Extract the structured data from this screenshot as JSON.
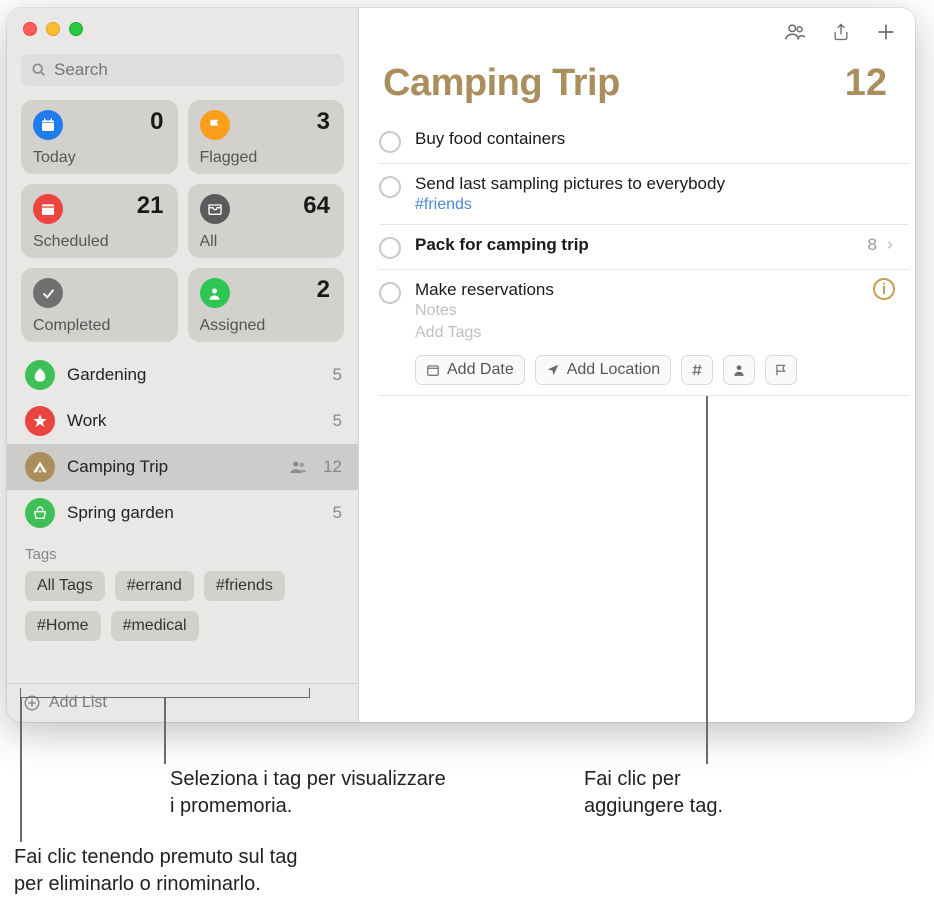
{
  "search": {
    "placeholder": "Search"
  },
  "smartLists": {
    "today": {
      "label": "Today",
      "count": "0",
      "color": "#227bea"
    },
    "flagged": {
      "label": "Flagged",
      "count": "3",
      "color": "#fa9e1b"
    },
    "scheduled": {
      "label": "Scheduled",
      "count": "21",
      "color": "#eb4542"
    },
    "all": {
      "label": "All",
      "count": "64",
      "color": "#5b5b5d"
    },
    "completed": {
      "label": "Completed",
      "count": "",
      "color": "#707072"
    },
    "assigned": {
      "label": "Assigned",
      "count": "2",
      "color": "#30c552"
    }
  },
  "lists": [
    {
      "name": "Gardening",
      "count": "5",
      "color": "#3fbf57",
      "selected": false,
      "shared": false,
      "icon": "leaf"
    },
    {
      "name": "Work",
      "count": "5",
      "color": "#eb4542",
      "selected": false,
      "shared": false,
      "icon": "star"
    },
    {
      "name": "Camping Trip",
      "count": "12",
      "color": "#ab8e5e",
      "selected": true,
      "shared": true,
      "icon": "tent"
    },
    {
      "name": "Spring garden",
      "count": "5",
      "color": "#3fbf57",
      "selected": false,
      "shared": false,
      "icon": "basket"
    }
  ],
  "tagsSection": {
    "title": "Tags",
    "items": [
      "All Tags",
      "#errand",
      "#friends",
      "#Home",
      "#medical"
    ]
  },
  "addList": "Add List",
  "main": {
    "title": "Camping Trip",
    "count": "12",
    "todos": [
      {
        "title": "Buy food containers"
      },
      {
        "title": "Send last sampling pictures to everybody",
        "tag": "#friends"
      },
      {
        "title": "Pack for camping trip",
        "bold": true,
        "subcount": "8"
      },
      {
        "title": "Make reservations",
        "editing": true,
        "notes": "Notes",
        "addTags": "Add Tags",
        "chips": {
          "date": "Add Date",
          "location": "Add Location"
        }
      }
    ]
  },
  "callouts": {
    "tagSelect": "Seleziona i tag per visualizzare\ni promemoria.",
    "tagAdd": "Fai clic per\naggiungere tag.",
    "tagEdit": "Fai clic tenendo premuto sul tag\nper eliminarlo o rinominarlo."
  }
}
